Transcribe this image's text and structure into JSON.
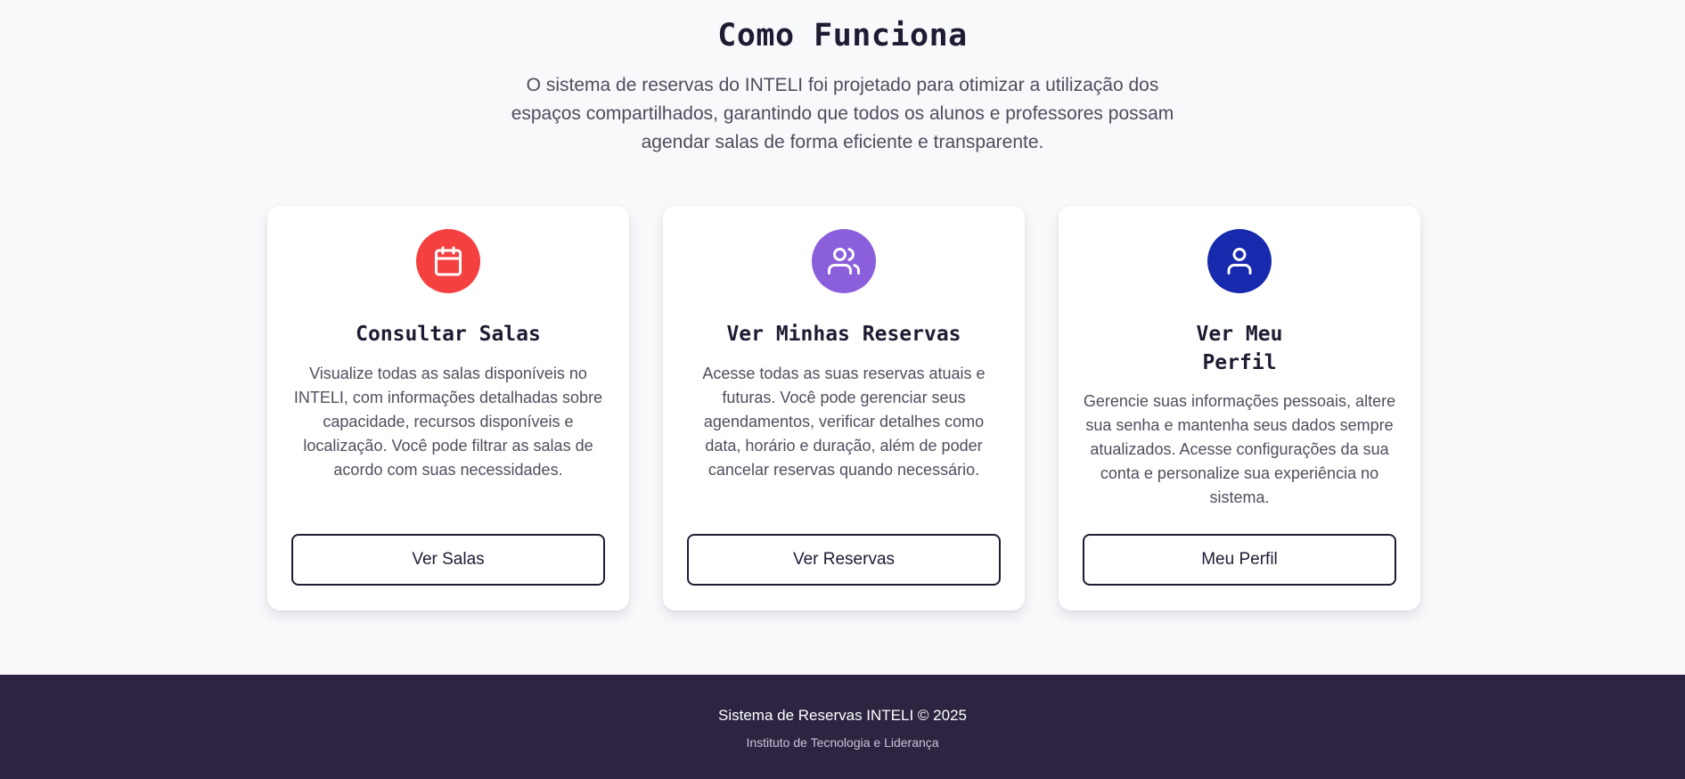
{
  "how_it_works": {
    "title": "Como Funciona",
    "description": "O sistema de reservas do INTELI foi projetado para otimizar a utilização dos espaços compartilhados, garantindo que todos os alunos e professores possam agendar salas de forma eficiente e transparente."
  },
  "cards": [
    {
      "icon": "calendar-icon",
      "icon_color": "#f54040",
      "title": "Consultar Salas",
      "text": "Visualize todas as salas disponíveis no INTELI, com informações detalhadas sobre capacidade, recursos disponíveis e localização. Você pode filtrar as salas de acordo com suas necessidades.",
      "button": "Ver Salas"
    },
    {
      "icon": "users-icon",
      "icon_color": "#8b5fdc",
      "title": "Ver Minhas Reservas",
      "text": "Acesse todas as suas reservas atuais e futuras. Você pode gerenciar seus agendamentos, verificar detalhes como data, horário e duração, além de poder cancelar reservas quando necessário.",
      "button": "Ver Reservas"
    },
    {
      "icon": "user-icon",
      "icon_color": "#1729ad",
      "title": "Ver Meu Perfil",
      "text": "Gerencie suas informações pessoais, altere sua senha e mantenha seus dados sempre atualizados. Acesse configurações da sua conta e personalize sua experiência no sistema.",
      "button": "Meu Perfil"
    }
  ],
  "footer": {
    "title": "Sistema de Reservas INTELI © 2025",
    "subtitle": "Instituto de Tecnologia e Liderança"
  },
  "colors": {
    "background": "#f8f9fb",
    "footer_background": "#2d2441",
    "heading": "#1f1b33"
  }
}
